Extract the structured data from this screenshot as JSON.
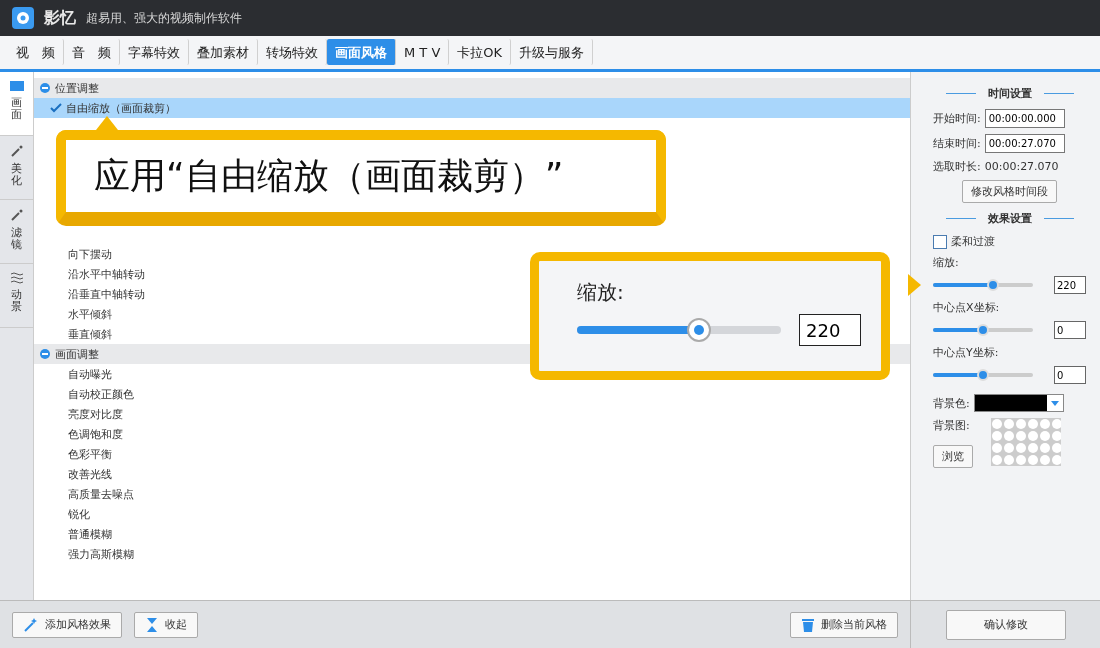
{
  "window": {
    "title": "影忆",
    "subtitle": "超易用、强大的视频制作软件"
  },
  "tabs": [
    {
      "label": "视　频",
      "selected": false
    },
    {
      "label": "音　频",
      "selected": false
    },
    {
      "label": "字幕特效",
      "selected": false
    },
    {
      "label": "叠加素材",
      "selected": false
    },
    {
      "label": "转场特效",
      "selected": false
    },
    {
      "label": "画面风格",
      "selected": true
    },
    {
      "label": "M T V",
      "selected": false
    },
    {
      "label": "卡拉OK",
      "selected": false
    },
    {
      "label": "升级与服务",
      "selected": false
    }
  ],
  "side_tabs": [
    {
      "label": "画面",
      "selected": true
    },
    {
      "label": "美化",
      "selected": false
    },
    {
      "label": "滤镜",
      "selected": false
    },
    {
      "label": "动景",
      "selected": false
    }
  ],
  "style_groups": [
    {
      "label": "位置调整",
      "expanded": true,
      "items": [
        {
          "label": "自由缩放（画面裁剪）",
          "selected": true
        },
        {
          "label": "向下摆动",
          "selected": false
        },
        {
          "label": "沿水平中轴转动",
          "selected": false
        },
        {
          "label": "沿垂直中轴转动",
          "selected": false
        },
        {
          "label": "水平倾斜",
          "selected": false
        },
        {
          "label": "垂直倾斜",
          "selected": false
        }
      ]
    },
    {
      "label": "画面调整",
      "expanded": true,
      "items": [
        {
          "label": "自动曝光",
          "selected": false
        },
        {
          "label": "自动校正颜色",
          "selected": false
        },
        {
          "label": "亮度对比度",
          "selected": false
        },
        {
          "label": "色调饱和度",
          "selected": false
        },
        {
          "label": "色彩平衡",
          "selected": false
        },
        {
          "label": "改善光线",
          "selected": false
        },
        {
          "label": "高质量去噪点",
          "selected": false
        },
        {
          "label": "锐化",
          "selected": false
        },
        {
          "label": "普通模糊",
          "selected": false
        },
        {
          "label": "强力高斯模糊",
          "selected": false
        }
      ]
    }
  ],
  "caption_callout": {
    "text": "应用“自由缩放（画面裁剪）”"
  },
  "zoom_callout": {
    "label": "缩放:",
    "level": 0.6,
    "value": "220"
  },
  "bottom_buttons": [
    {
      "label": "添加风格效果",
      "kind": "add"
    },
    {
      "label": "收起",
      "kind": "collapse"
    },
    {
      "label": "删除当前风格",
      "kind": "delete"
    }
  ],
  "time_settings": {
    "heading": "时间设置",
    "fields": [
      {
        "label": "开始时间:",
        "value": "00:00:00.000"
      },
      {
        "label": "结束时间:",
        "value": "00:00:27.070"
      }
    ],
    "duration_label": "选取时长:",
    "duration": "00:00:27.070",
    "button": "修改风格时间段"
  },
  "effect_settings": {
    "heading": "效果设置",
    "soften": {
      "label": "柔和过渡",
      "checked": false
    },
    "sliders": [
      {
        "label": "缩放:",
        "level": 0.6,
        "value": "220"
      },
      {
        "label": "中心点X坐标:",
        "level": 0.5,
        "value": "0"
      },
      {
        "label": "中心点Y坐标:",
        "level": 0.5,
        "value": "0"
      }
    ],
    "bg_color_label": "背景色:",
    "bg_image_label": "背景图:",
    "browse": "浏览"
  },
  "confirm_button": "确认修改"
}
